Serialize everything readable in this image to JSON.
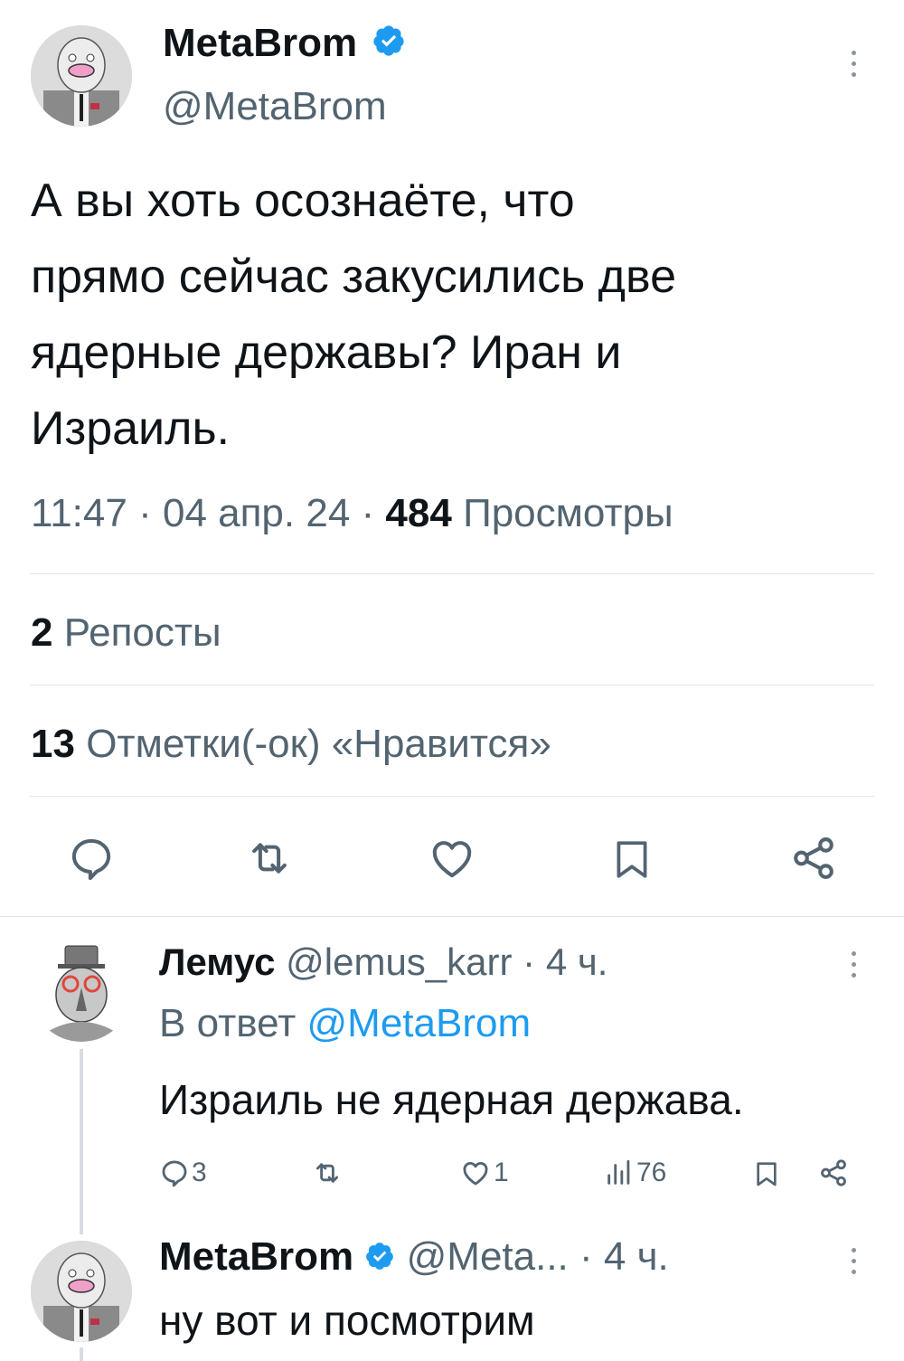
{
  "tweet": {
    "author_name": "MetaBrom",
    "author_handle": "@MetaBrom",
    "text_lines": [
      "А вы хоть осознаёте, что",
      "прямо сейчас закусились две",
      "ядерные державы? Иран и",
      "Израиль."
    ],
    "time": "11:47",
    "date": "04 апр. 24",
    "views_count": "484",
    "views_label": "Просмотры",
    "reposts_count": "2",
    "reposts_label": "Репосты",
    "likes_count": "13",
    "likes_label": "Отметки(-ок) «Нравится»",
    "actions": [
      "reply-icon",
      "repost-icon",
      "like-icon",
      "bookmark-icon",
      "share-icon"
    ]
  },
  "reply1": {
    "author_name": "Лемус",
    "author_handle": "@lemus_karr",
    "time": "· 4 ч.",
    "reply_to_prefix": "В ответ",
    "reply_to_handle": "@MetaBrom",
    "text": "Израиль не ядерная держава.",
    "replies_count": "3",
    "likes_count": "1",
    "views_count": "76"
  },
  "reply2": {
    "author_name": "MetaBrom",
    "author_handle": "@Meta...",
    "time": "· 4 ч.",
    "text": "ну вот и посмотрим"
  },
  "colors": {
    "verified": "#1d9bf0",
    "link": "#1d9bf0",
    "muted": "#536471",
    "text": "#0f1419"
  }
}
